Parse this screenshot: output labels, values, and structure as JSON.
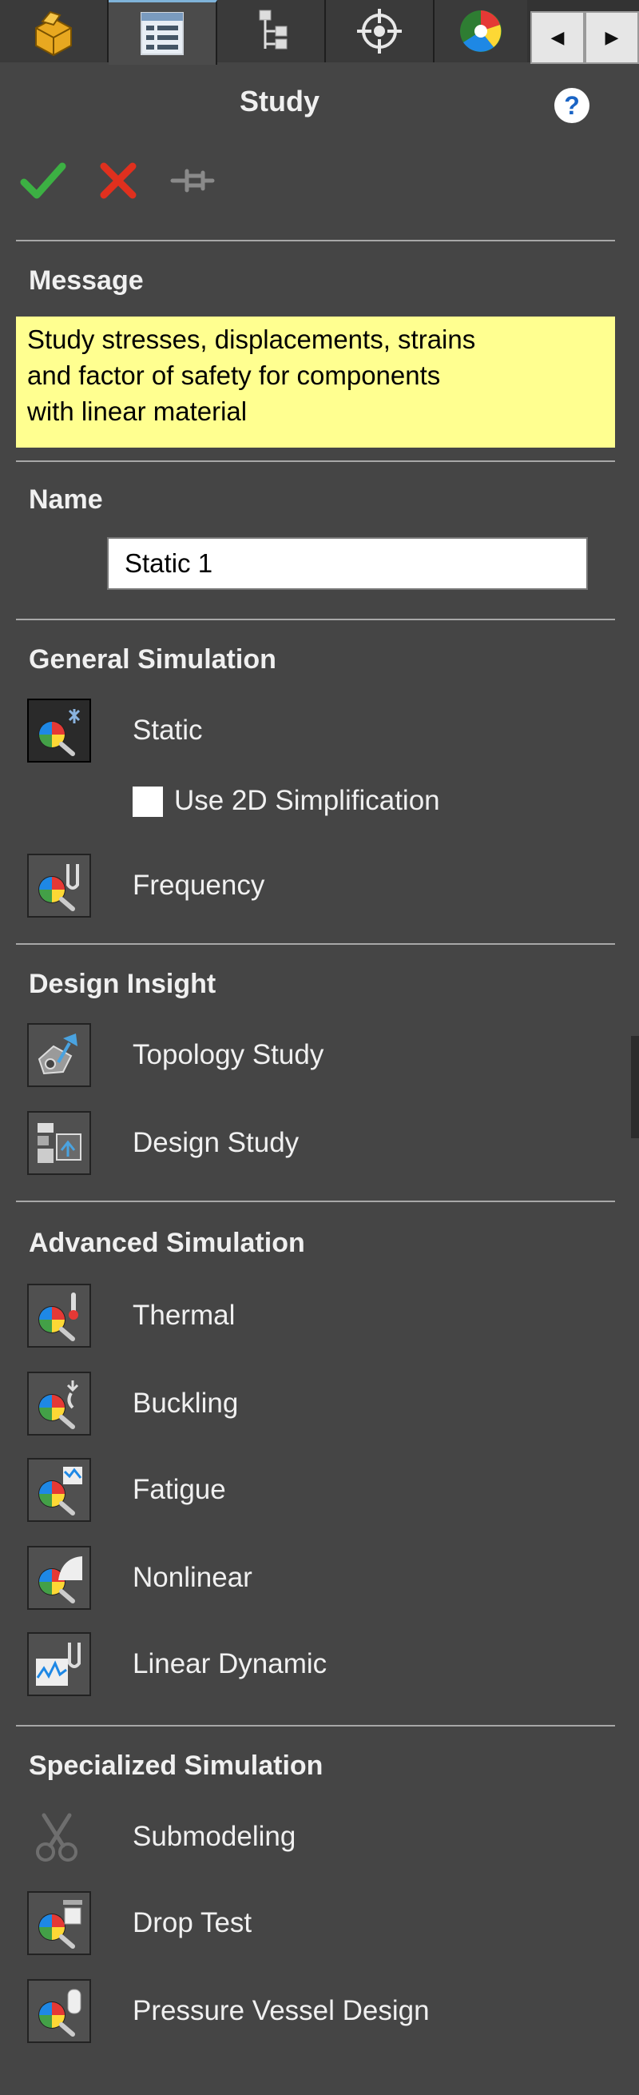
{
  "tabs": [
    {
      "icon": "part-icon"
    },
    {
      "icon": "property-manager-icon",
      "active": true
    },
    {
      "icon": "configuration-manager-icon"
    },
    {
      "icon": "dimxpert-icon"
    },
    {
      "icon": "appearance-icon"
    }
  ],
  "tab_scroll": {
    "left": "◀",
    "right": "▶"
  },
  "panel": {
    "title": "Study",
    "help": "?"
  },
  "message": {
    "heading": "Message",
    "lines": [
      "Study stresses, displacements, strains",
      "and factor of safety  for components",
      "with linear material"
    ]
  },
  "name": {
    "heading": "Name",
    "value": "Static 1"
  },
  "general": {
    "heading": "General Simulation",
    "static": "Static",
    "use_2d": "Use 2D Simplification",
    "frequency": "Frequency"
  },
  "design": {
    "heading": "Design Insight",
    "topology": "Topology Study",
    "design_study": "Design Study"
  },
  "advanced": {
    "heading": "Advanced Simulation",
    "thermal": "Thermal",
    "buckling": "Buckling",
    "fatigue": "Fatigue",
    "nonlinear": "Nonlinear",
    "linear_dynamic": "Linear Dynamic"
  },
  "specialized": {
    "heading": "Specialized Simulation",
    "submodeling": "Submodeling",
    "drop_test": "Drop Test",
    "pressure_vessel": "Pressure Vessel Design"
  },
  "colors": {
    "panel_bg": "#454545",
    "message_bg": "#ffff90",
    "ok_green": "#3cb043",
    "cancel_red": "#e0301e"
  }
}
